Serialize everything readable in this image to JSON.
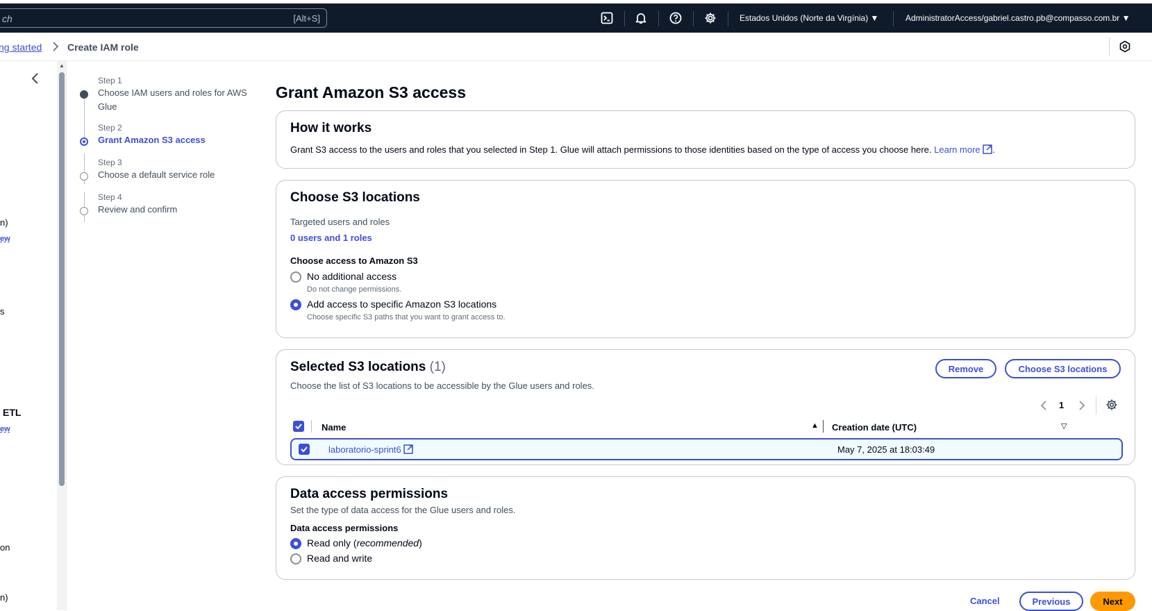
{
  "topbar": {
    "search_placeholder": "ch",
    "search_shortcut": "[Alt+S]",
    "region": "Estados Unidos (Norte da Virgínia) ▼",
    "account": "AdministratorAccess/gabriel.castro.pb@compasso.com.br ▼",
    "icons": [
      "cloudshell-icon",
      "bell-icon",
      "help-icon",
      "settings-icon"
    ]
  },
  "breadcrumb": {
    "parent": "ng started",
    "separator": ">",
    "current": "Create IAM role"
  },
  "leftnav": {
    "fragments": [
      "n)",
      "ew",
      "s",
      "ETL",
      "ew",
      "on",
      "n)"
    ]
  },
  "steps": [
    {
      "number": "Step 1",
      "title": "Choose IAM users and roles for AWS Glue",
      "state": "done"
    },
    {
      "number": "Step 2",
      "title": "Grant Amazon S3 access",
      "state": "active"
    },
    {
      "number": "Step 3",
      "title": "Choose a default service role",
      "state": "todo"
    },
    {
      "number": "Step 4",
      "title": "Review and confirm",
      "state": "todo"
    }
  ],
  "page": {
    "title": "Grant Amazon S3 access"
  },
  "how_it_works": {
    "title": "How it works",
    "text": "Grant S3 access to the users and roles that you selected in Step 1. Glue will attach permissions to those identities based on the type of access you choose here.",
    "learn_more": "Learn more"
  },
  "choose_locations": {
    "title": "Choose S3 locations",
    "targeted_label": "Targeted users and roles",
    "targeted_value": "0 users and 1 roles",
    "access_label": "Choose access to Amazon S3",
    "options": [
      {
        "label": "No additional access",
        "desc": "Do not change permissions.",
        "checked": false
      },
      {
        "label": "Add access to specific Amazon S3 locations",
        "desc": "Choose specific S3 paths that you want to grant access to.",
        "checked": true
      }
    ]
  },
  "selected_locations": {
    "title": "Selected S3 locations",
    "count": "(1)",
    "description": "Choose the list of S3 locations to be accessible by the Glue users and roles.",
    "remove_button": "Remove",
    "choose_button": "Choose S3 locations",
    "page_number": "1",
    "columns": [
      "Name",
      "Creation date (UTC)"
    ],
    "rows": [
      {
        "name": "laboratorio-sprint6",
        "created": "May 7, 2025 at 18:03:49",
        "selected": true
      }
    ]
  },
  "data_access": {
    "title": "Data access permissions",
    "description": "Set the type of data access for the Glue users and roles.",
    "label": "Data access permissions",
    "read_only_label": "Read only (",
    "read_only_emph": "recommended",
    "read_only_close": ")",
    "read_write_label": "Read and write",
    "selected": "read_only"
  },
  "footer": {
    "cancel": "Cancel",
    "previous": "Previous",
    "next": "Next"
  },
  "colors": {
    "accent": "#3b4fd9",
    "topbar": "#0f1b2a",
    "primary_button": "#ff9900"
  }
}
